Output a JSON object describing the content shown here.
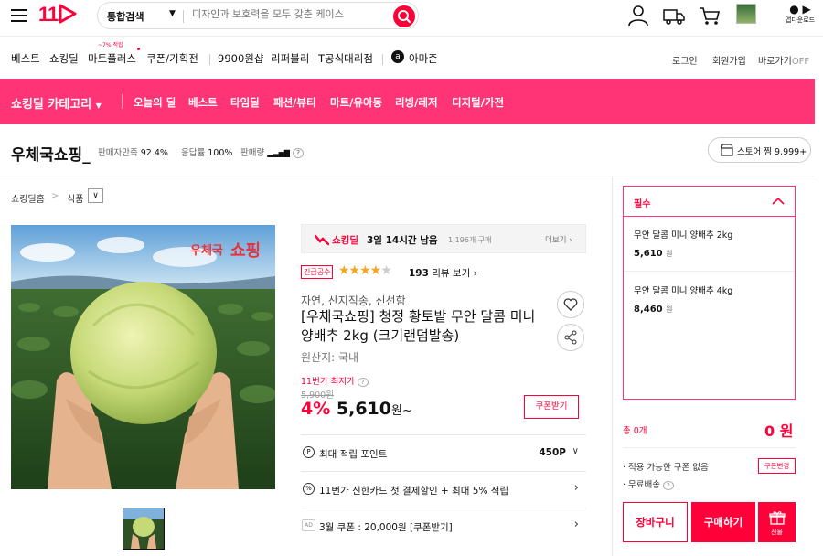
{
  "header": {
    "logo": "11",
    "search": {
      "category": "통합검색",
      "placeholder": "디자인과 보호력을 모두 갖춘 케이스"
    },
    "app_download": "앱다운로드"
  },
  "nav": {
    "items": [
      "베스트",
      "쇼킹딜",
      "마트플러스",
      "쿠폰/기획전",
      "9900원샵",
      "리퍼블리",
      "T공식대리점",
      "아마존"
    ],
    "mart_tag": "~7% 적립",
    "right": {
      "login": "로그인",
      "join": "회원가입",
      "shortcut": "바로가기",
      "shortcut_state": "OFF"
    }
  },
  "pink_bar": {
    "category_label": "쇼킹딜 카테고리",
    "items": [
      "오늘의 딜",
      "베스트",
      "타임딜",
      "패션/뷰티",
      "마트/유아동",
      "리빙/레저",
      "디지털/가전"
    ],
    "color": "#ff3476"
  },
  "seller": {
    "name": "우체국쇼핑_",
    "satisfaction_label": "판매자만족",
    "satisfaction_value": "92.4%",
    "response_label": "응답률",
    "response_value": "100%",
    "volume_label": "판매량",
    "store_button": "스토어 찜 9,999+"
  },
  "breadcrumb": {
    "root": "쇼킹딜홈",
    "category": "식품"
  },
  "image": {
    "overlay_text_1": "우체국",
    "overlay_text_2": "쇼핑"
  },
  "deal": {
    "label": "쇼킹딜",
    "remaining": "3일 14시간 남음",
    "purchases": "1,196개 구매",
    "more": "더보기"
  },
  "product": {
    "badge": "긴급공수",
    "rating": 4,
    "review_count": "193",
    "review_label": "리뷰 보기",
    "subtitle": "자연, 산지직송, 신선함",
    "title": "[우체국쇼핑] 청정 황토밭 무안 달콤 미니 양배추 2kg (크기랜덤발송)",
    "origin": "원산지: 국내",
    "lowest_label": "11번가 최저가",
    "original_price": "5,900원",
    "discount": "4%",
    "price": "5,610",
    "price_unit": "원~",
    "coupon_button": "쿠폰받기"
  },
  "benefits": [
    {
      "icon": "P",
      "label": "최대 적립 포인트",
      "value": "450P"
    },
    {
      "icon": "%",
      "label": "11번가 신한카드 첫 결제할인 + 최대 5% 적립"
    },
    {
      "icon": "AD",
      "label": "3월 쿠폰 : 20,000원 [쿠폰받기]"
    }
  ],
  "options_panel": {
    "title": "필수",
    "options": [
      {
        "name": "무안 달콤 미니 양배추 2kg",
        "price": "5,610",
        "unit": "원"
      },
      {
        "name": "무안 달콤 미니 양배추 4kg",
        "price": "8,460",
        "unit": "원"
      }
    ]
  },
  "summary": {
    "total_label": "총 0개",
    "total_value": "0 원",
    "coupon_line": "적용 가능한 쿠폰 없음",
    "coupon_change": "쿠폰변경",
    "shipping": "무료배송",
    "cart": "장바구니",
    "buy": "구매하기",
    "gift": "선물"
  }
}
